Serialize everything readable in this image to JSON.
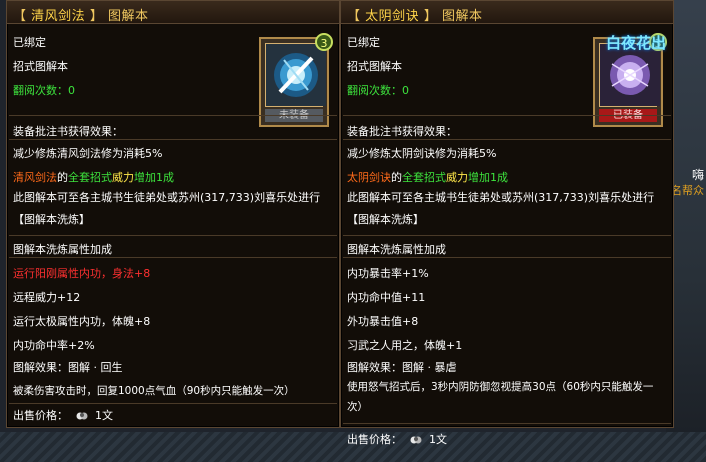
{
  "background": {
    "right_text_1": "嗨",
    "right_text_2": "名帮众",
    "overlay_watermark": "白夜花出"
  },
  "left": {
    "title_bracket_open": "【",
    "title_name": "清风剑法",
    "title_bracket_close": "】",
    "title_suffix": "图解本",
    "bound": "已绑定",
    "type": "招式图解本",
    "read_label": "翻阅次数：",
    "read_value": "0",
    "icon_status": "未装备",
    "badge": "3",
    "effect_head": "装备批注书获得效果：",
    "effect_1": "减少修炼清风剑法修为消耗5%",
    "effect_2_a": "清风剑法",
    "effect_2_b": "的",
    "effect_2_c": "全套招式",
    "effect_2_d": "威力",
    "effect_2_e": "增加1成",
    "effect_3": "此图解本可至各主城书生徒弟处或苏州(317,733)刘喜乐处进行【图解本洗炼】",
    "attr_head": "图解本洗炼属性加成",
    "attrs": [
      {
        "text": "运行阳刚属性内功，身法",
        "value": "+8",
        "color": "#ff3030"
      },
      {
        "text": "远程威力",
        "value": "+12",
        "color": "#ffffff"
      },
      {
        "text": "运行太极属性内功，体魄",
        "value": "+8",
        "color": "#ffffff"
      },
      {
        "text": "内功命中率",
        "value": "+2%",
        "color": "#ffffff"
      }
    ],
    "diagram_effect": "图解效果：图解 · 回生",
    "diagram_desc": "被柔伤害攻击时，回复1000点气血（90秒内只能触发一次）",
    "sell_label": "出售价格：",
    "sell_value": "1文"
  },
  "right": {
    "title_bracket_open": "【",
    "title_name": "太阴剑诀",
    "title_bracket_close": "】",
    "title_suffix": "图解本",
    "bound": "已绑定",
    "type": "招式图解本",
    "read_label": "翻阅次数：",
    "read_value": "0",
    "icon_status": "已装备",
    "badge": "3",
    "effect_head": "装备批注书获得效果：",
    "effect_1": "减少修炼太阴剑诀修为消耗5%",
    "effect_2_a": "太阴剑诀",
    "effect_2_b": "的",
    "effect_2_c": "全套招式",
    "effect_2_d": "威力",
    "effect_2_e": "增加1成",
    "effect_3": "此图解本可至各主城书生徒弟处或苏州(317,733)刘喜乐处进行【图解本洗炼】",
    "attr_head": "图解本洗炼属性加成",
    "attrs": [
      {
        "text": "内功暴击率",
        "value": "+1%",
        "color": "#ffffff"
      },
      {
        "text": "内功命中值",
        "value": "+11",
        "color": "#ffffff"
      },
      {
        "text": "外功暴击值",
        "value": "+8",
        "color": "#ffffff"
      },
      {
        "text": "习武之人用之，体魄",
        "value": "+1",
        "color": "#ffffff"
      }
    ],
    "diagram_effect": "图解效果：图解 · 暴虐",
    "diagram_desc": "使用怒气招式后，3秒内阴防御忽视提高30点（60秒内只能触发一次）",
    "sell_label": "出售价格：",
    "sell_value": "1文"
  }
}
